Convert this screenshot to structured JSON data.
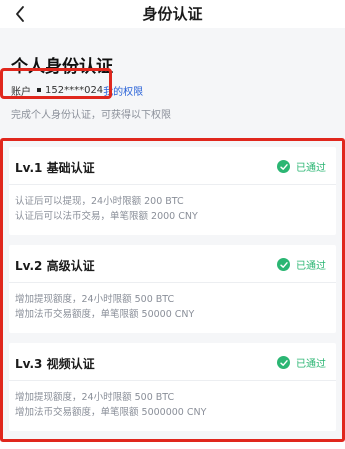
{
  "nav": {
    "title": "身份认证"
  },
  "header": {
    "title": "个人身份认证",
    "account_label": "账户",
    "account_phone": "152****024",
    "my_rights_link": "我的权限",
    "description": "完成个人身份认证，可获得以下权限"
  },
  "levels": [
    {
      "title": "Lv.1 基础认证",
      "status": "已通过",
      "line1": "认证后可以提现，24小时限额 200 BTC",
      "line2": "认证后可以法币交易，单笔限额 2000 CNY"
    },
    {
      "title": "Lv.2 高级认证",
      "status": "已通过",
      "line1": "增加提现额度，24小时限额 500 BTC",
      "line2": "增加法币交易额度，单笔限额 50000 CNY"
    },
    {
      "title": "Lv.3 视频认证",
      "status": "已通过",
      "line1": "增加提现额度，24小时限额 500 BTC",
      "line2": "增加法币交易额度，单笔限额 5000000 CNY"
    }
  ],
  "colors": {
    "accent_link": "#2a63d8",
    "success": "#2bb673",
    "highlight": "#e0271d"
  }
}
